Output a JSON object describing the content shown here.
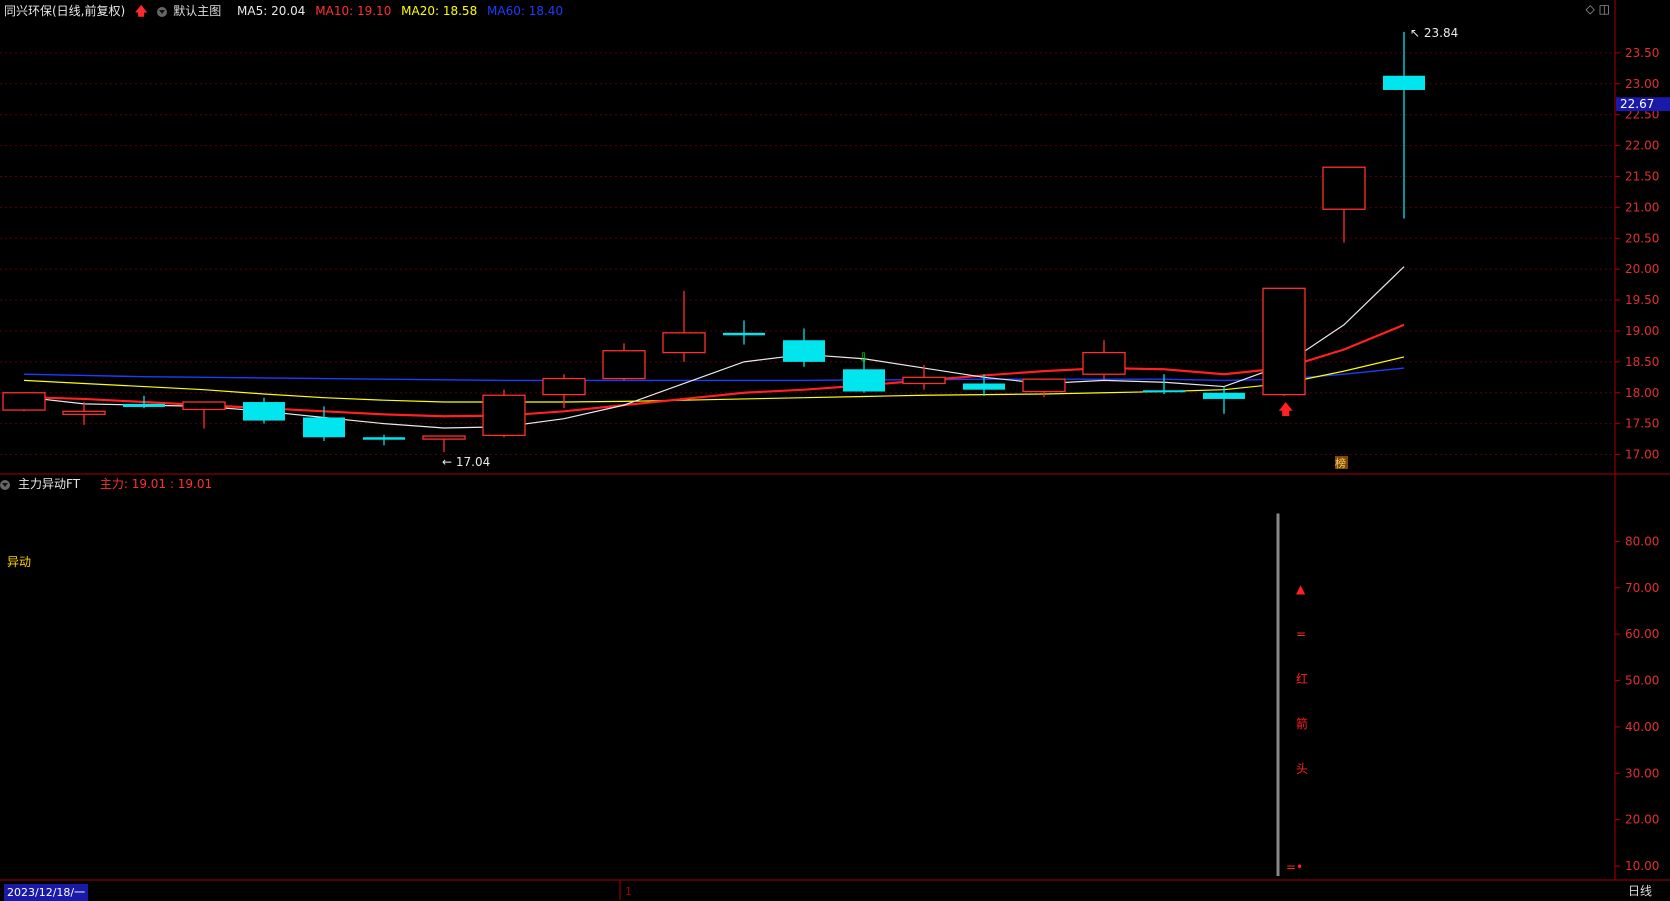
{
  "header": {
    "stock_name": "同兴环保(日线,前复权)",
    "indicator_name": "默认主图",
    "ma5_label": "MA5: 20.04",
    "ma10_label": "MA10: 19.10",
    "ma20_label": "MA20: 18.58",
    "ma60_label": "MA60: 18.40",
    "icons": "◇ ◫"
  },
  "colors": {
    "up": "#ff3030",
    "down": "#00e5ee",
    "ma5": "#e8e8e8",
    "ma10": "#ff2020",
    "ma20": "#ffff00",
    "ma60": "#1e3cff",
    "grid": "#5a0000",
    "axis": "#aa0000"
  },
  "chart_data": [
    {
      "type": "candlestick",
      "y_ticks": [
        "17.00",
        "17.50",
        "18.00",
        "18.50",
        "19.00",
        "19.50",
        "20.00",
        "20.50",
        "21.00",
        "21.50",
        "22.00",
        "22.50",
        "23.00",
        "23.50"
      ],
      "ylim": [
        16.75,
        24.0
      ],
      "current_price": "22.67",
      "high_label": "23.84",
      "low_label": "17.04",
      "ohlc": [
        {
          "o": 17.72,
          "h": 18.0,
          "l": 17.7,
          "c": 18.0
        },
        {
          "o": 17.65,
          "h": 17.85,
          "l": 17.48,
          "c": 17.7
        },
        {
          "o": 17.82,
          "h": 17.95,
          "l": 17.75,
          "c": 17.77
        },
        {
          "o": 17.73,
          "h": 17.85,
          "l": 17.42,
          "c": 17.85
        },
        {
          "o": 17.85,
          "h": 17.92,
          "l": 17.5,
          "c": 17.55
        },
        {
          "o": 17.6,
          "h": 17.78,
          "l": 17.22,
          "c": 17.28
        },
        {
          "o": 17.28,
          "h": 17.32,
          "l": 17.15,
          "c": 17.24
        },
        {
          "o": 17.25,
          "h": 17.3,
          "l": 17.04,
          "c": 17.3
        },
        {
          "o": 17.31,
          "h": 18.05,
          "l": 17.28,
          "c": 17.96
        },
        {
          "o": 17.97,
          "h": 18.3,
          "l": 17.75,
          "c": 18.23
        },
        {
          "o": 18.23,
          "h": 18.8,
          "l": 18.2,
          "c": 18.68
        },
        {
          "o": 18.65,
          "h": 19.65,
          "l": 18.5,
          "c": 18.97
        },
        {
          "o": 18.97,
          "h": 19.17,
          "l": 18.78,
          "c": 18.93
        },
        {
          "o": 18.85,
          "h": 19.04,
          "l": 18.42,
          "c": 18.5
        },
        {
          "o": 18.38,
          "h": 18.55,
          "l": 18.0,
          "c": 18.02
        },
        {
          "o": 18.15,
          "h": 18.45,
          "l": 18.05,
          "c": 18.25
        },
        {
          "o": 18.15,
          "h": 18.3,
          "l": 17.95,
          "c": 18.05
        },
        {
          "o": 18.02,
          "h": 18.22,
          "l": 17.93,
          "c": 18.22
        },
        {
          "o": 18.3,
          "h": 18.85,
          "l": 18.22,
          "c": 18.65
        },
        {
          "o": 18.04,
          "h": 18.3,
          "l": 17.98,
          "c": 18.03
        },
        {
          "o": 18.0,
          "h": 18.1,
          "l": 17.66,
          "c": 17.9
        },
        {
          "o": 17.97,
          "h": 19.69,
          "l": 17.95,
          "c": 19.69
        },
        {
          "o": 20.97,
          "h": 21.65,
          "l": 20.43,
          "c": 21.65
        },
        {
          "o": 23.13,
          "h": 23.84,
          "l": 20.82,
          "c": 22.9
        }
      ],
      "ma5": [
        17.93,
        17.82,
        17.8,
        17.78,
        17.7,
        17.6,
        17.5,
        17.43,
        17.45,
        17.58,
        17.8,
        18.15,
        18.5,
        18.62,
        18.55,
        18.4,
        18.25,
        18.15,
        18.2,
        18.17,
        18.1,
        18.45,
        19.1,
        20.04
      ],
      "ma10": [
        17.93,
        17.9,
        17.85,
        17.8,
        17.75,
        17.7,
        17.65,
        17.62,
        17.63,
        17.7,
        17.8,
        17.9,
        18.0,
        18.05,
        18.12,
        18.2,
        18.28,
        18.35,
        18.4,
        18.38,
        18.3,
        18.4,
        18.7,
        19.1
      ],
      "ma20": [
        18.2,
        18.15,
        18.1,
        18.05,
        17.98,
        17.92,
        17.88,
        17.85,
        17.85,
        17.85,
        17.86,
        17.88,
        17.9,
        17.92,
        17.94,
        17.96,
        17.97,
        17.98,
        18.0,
        18.02,
        18.05,
        18.15,
        18.35,
        18.58
      ],
      "ma60": [
        18.3,
        18.28,
        18.26,
        18.25,
        18.24,
        18.23,
        18.22,
        18.21,
        18.2,
        18.2,
        18.2,
        18.2,
        18.2,
        18.2,
        18.21,
        18.21,
        18.22,
        18.22,
        18.22,
        18.22,
        18.2,
        18.22,
        18.3,
        18.4
      ],
      "markers": {
        "down_arrow_index": 14,
        "up_arrow_index": 21,
        "flag_index": 22,
        "flag_text": "榜"
      }
    },
    {
      "type": "indicator",
      "title": "主力异动FT",
      "value_label": "主力: 19.01 : 19.01",
      "side_label": "异动",
      "y_ticks": [
        "10.00",
        "20.00",
        "30.00",
        "40.00",
        "50.00",
        "60.00",
        "70.00",
        "80.00"
      ],
      "ylim": [
        7,
        90
      ],
      "vertical_text": [
        "▲",
        "=",
        "红",
        "箭",
        "头"
      ],
      "bar_index": 21,
      "bar_value": 86,
      "bottom_mark": "=•"
    }
  ],
  "footer": {
    "date": "2023/12/18/一",
    "marker": "1",
    "period": "日线"
  }
}
